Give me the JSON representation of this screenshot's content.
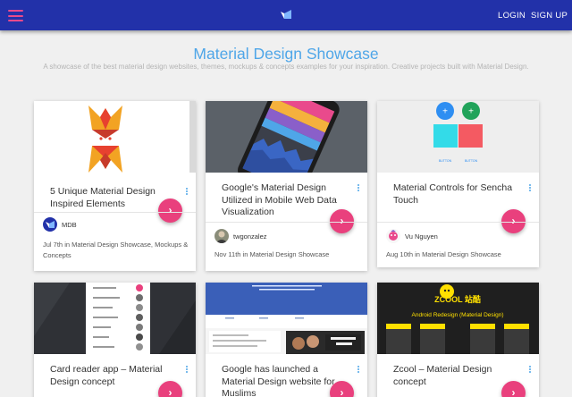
{
  "header": {
    "menu_icon": "hamburger-menu-icon",
    "logo_icon": "mdb-logo-icon",
    "login_label": "LOGIN",
    "signup_label": "SIGN UP",
    "bar_color": "#2231a9",
    "accent_color": "#e94a8c"
  },
  "hero": {
    "title": "Material Design Showcase",
    "subtitle": "A showcase of the best material design websites, themes, mockups & concepts examples for your inspiration. Creative projects built with Material Design."
  },
  "cards": [
    {
      "title": "5 Unique Material Design Inspired Elements",
      "author": "MDB",
      "date": "Jul 7th",
      "in_label": "in",
      "categories_text": "Material Design Showcase, Mockups & Concepts"
    },
    {
      "title": "Google's Material Design Utilized in Mobile Web Data Visualization",
      "author": "twgonzalez",
      "date": "Nov 11th",
      "in_label": "in",
      "categories_text": "Material Design Showcase"
    },
    {
      "title": "Material Controls for Sencha Touch",
      "author": "Vu Nguyen",
      "date": "Aug 10th",
      "in_label": "in",
      "categories_text": "Material Design Showcase"
    },
    {
      "title": "Card reader app – Material Design concept"
    },
    {
      "title": "Google has launched a Material Design website for Muslims"
    },
    {
      "title": "Zcool – Material Design concept",
      "thumb_text": "ZCOOL 站酷",
      "thumb_subtext": "Android Redesign (Material Design)"
    }
  ],
  "thumb_labels": {
    "button_a": "BUTTON",
    "button_b": "BUTTON"
  },
  "fab_glyph": "›",
  "colors": {
    "title_blue": "#4fa6e8",
    "fab_pink": "#e9407d"
  }
}
